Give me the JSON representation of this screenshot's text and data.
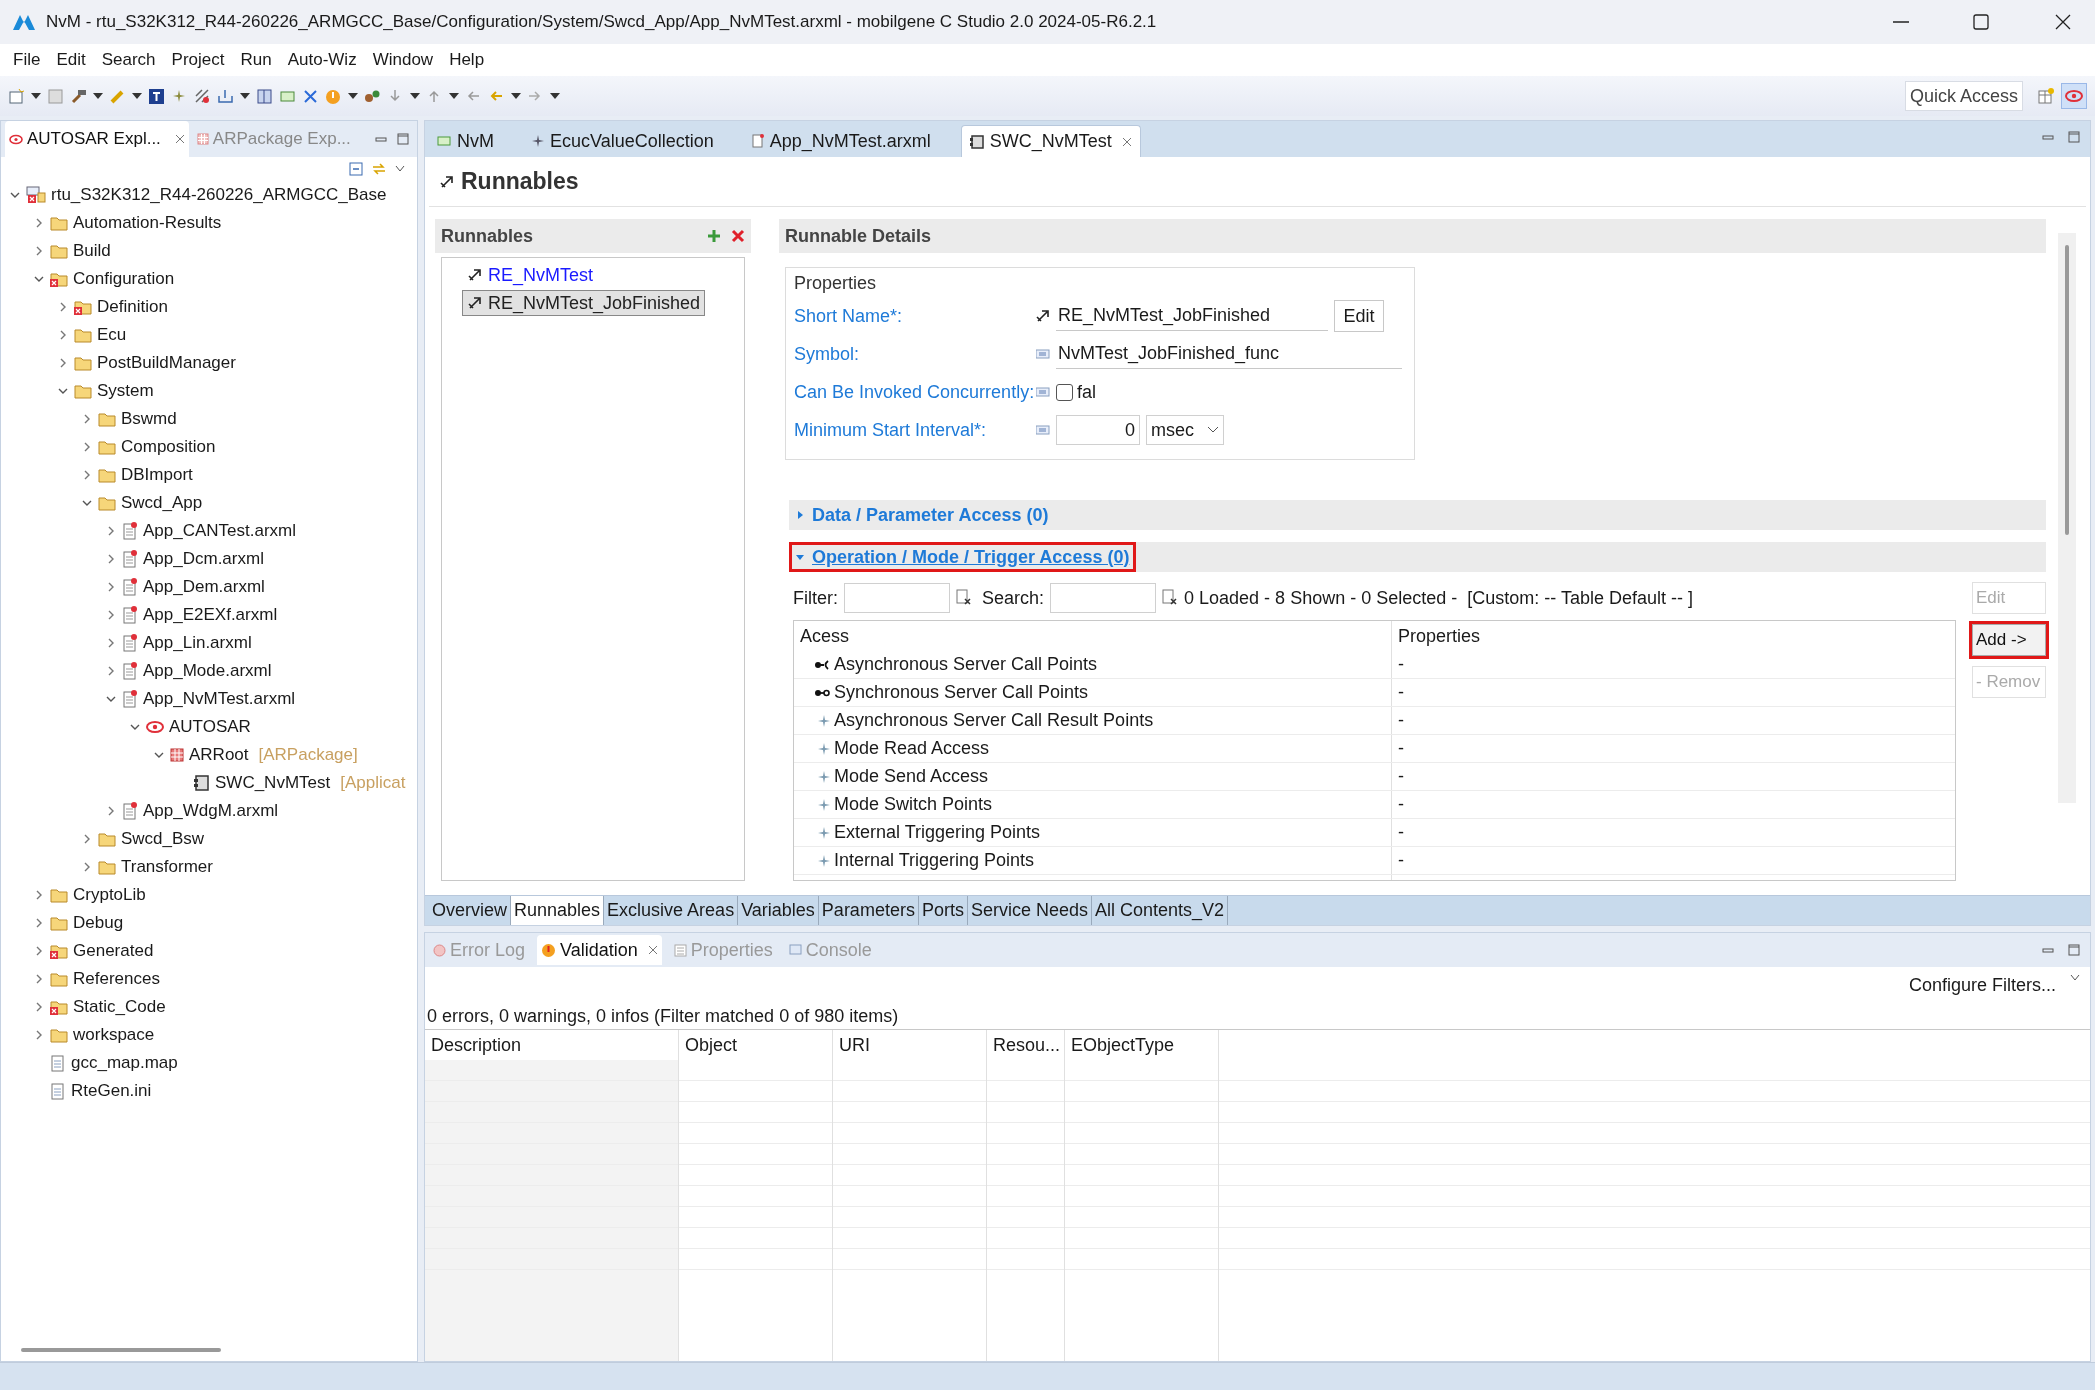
{
  "window": {
    "title": "NvM - rtu_S32K312_R44-260226_ARMGCC_Base/Configuration/System/Swcd_App/App_NvMTest.arxml - mobilgene C Studio 2.0 2024-05-R6.2.1"
  },
  "menu": [
    "File",
    "Edit",
    "Search",
    "Project",
    "Run",
    "Auto-Wiz",
    "Window",
    "Help"
  ],
  "quick_access": "Quick Access",
  "left_tabs": [
    {
      "label": "AUTOSAR Expl...",
      "selected": true
    },
    {
      "label": "ARPackage Exp...",
      "selected": false
    }
  ],
  "tree": {
    "items": [
      {
        "label": "rtu_S32K312_R44-260226_ARMGCC_Base",
        "kind": "project",
        "expanded": true,
        "children": [
          {
            "label": "Automation-Results",
            "kind": "folder",
            "expanded": false
          },
          {
            "label": "Build",
            "kind": "folder",
            "expanded": false
          },
          {
            "label": "Configuration",
            "kind": "folder-error",
            "expanded": true,
            "children": [
              {
                "label": "Definition",
                "kind": "folder-error",
                "expanded": false
              },
              {
                "label": "Ecu",
                "kind": "folder",
                "expanded": false
              },
              {
                "label": "PostBuildManager",
                "kind": "folder",
                "expanded": false
              },
              {
                "label": "System",
                "kind": "folder",
                "expanded": true,
                "children": [
                  {
                    "label": "Bswmd",
                    "kind": "folder",
                    "expanded": false
                  },
                  {
                    "label": "Composition",
                    "kind": "folder",
                    "expanded": false
                  },
                  {
                    "label": "DBImport",
                    "kind": "folder",
                    "expanded": false
                  },
                  {
                    "label": "Swcd_App",
                    "kind": "folder",
                    "expanded": true,
                    "children": [
                      {
                        "label": "App_CANTest.arxml",
                        "kind": "arxml",
                        "expanded": false
                      },
                      {
                        "label": "App_Dcm.arxml",
                        "kind": "arxml",
                        "expanded": false
                      },
                      {
                        "label": "App_Dem.arxml",
                        "kind": "arxml",
                        "expanded": false
                      },
                      {
                        "label": "App_E2EXf.arxml",
                        "kind": "arxml",
                        "expanded": false
                      },
                      {
                        "label": "App_Lin.arxml",
                        "kind": "arxml",
                        "expanded": false
                      },
                      {
                        "label": "App_Mode.arxml",
                        "kind": "arxml",
                        "expanded": false
                      },
                      {
                        "label": "App_NvMTest.arxml",
                        "kind": "arxml",
                        "expanded": true,
                        "children": [
                          {
                            "label": "AUTOSAR",
                            "kind": "autosar",
                            "expanded": true,
                            "children": [
                              {
                                "label": "ARRoot",
                                "type_label": "[ARPackage]",
                                "kind": "package",
                                "expanded": true,
                                "children": [
                                  {
                                    "label": "SWC_NvMTest",
                                    "type_label": "[Applicat",
                                    "kind": "component"
                                  }
                                ]
                              }
                            ]
                          }
                        ]
                      },
                      {
                        "label": "App_WdgM.arxml",
                        "kind": "arxml",
                        "expanded": false
                      }
                    ]
                  },
                  {
                    "label": "Swcd_Bsw",
                    "kind": "folder",
                    "expanded": false
                  },
                  {
                    "label": "Transformer",
                    "kind": "folder",
                    "expanded": false
                  }
                ]
              }
            ]
          },
          {
            "label": "CryptoLib",
            "kind": "folder",
            "expanded": false
          },
          {
            "label": "Debug",
            "kind": "folder",
            "expanded": false
          },
          {
            "label": "Generated",
            "kind": "folder-error",
            "expanded": false
          },
          {
            "label": "References",
            "kind": "folder",
            "expanded": false
          },
          {
            "label": "Static_Code",
            "kind": "folder-error",
            "expanded": false
          },
          {
            "label": "workspace",
            "kind": "folder",
            "expanded": false
          },
          {
            "label": "gcc_map.map",
            "kind": "file"
          },
          {
            "label": "RteGen.ini",
            "kind": "file"
          }
        ]
      }
    ]
  },
  "editor_tabs": [
    {
      "label": "NvM",
      "selected": false
    },
    {
      "label": "EcucValueCollection",
      "selected": false
    },
    {
      "label": "App_NvMTest.arxml",
      "selected": false
    },
    {
      "label": "SWC_NvMTest",
      "selected": true
    }
  ],
  "page_title": "Runnables",
  "runnables": {
    "title": "Runnables",
    "items": [
      {
        "label": "RE_NvMTest",
        "selected": false
      },
      {
        "label": "RE_NvMTest_JobFinished",
        "selected": true
      }
    ]
  },
  "details": {
    "title": "Runnable Details",
    "group": "Properties",
    "short_name": {
      "label": "Short Name*:",
      "value": "RE_NvMTest_JobFinished",
      "button": "Edit"
    },
    "symbol": {
      "label": "Symbol:",
      "value": "NvMTest_JobFinished_func"
    },
    "concurrent": {
      "label": "Can Be Invoked Concurrently:",
      "checked": false,
      "value": "fal"
    },
    "min_interval": {
      "label": "Minimum Start Interval*:",
      "value": "0",
      "unit": "msec"
    }
  },
  "sections": [
    {
      "title": "Data / Parameter Access (0)",
      "expanded": false,
      "highlighted": false
    },
    {
      "title": "Operation / Mode / Trigger Access (0)",
      "expanded": true,
      "highlighted": true
    }
  ],
  "filter": {
    "filter_label": "Filter:",
    "search_label": "Search:",
    "status": "0 Loaded - 8 Shown - 0 Selected -  [Custom: -- Table Default -- ]"
  },
  "access_table": {
    "columns": [
      "Acess",
      "Properties"
    ],
    "rows": [
      {
        "name": "Asynchronous Server Call Points",
        "kind": "async-call",
        "properties": "-"
      },
      {
        "name": "Synchronous Server Call Points",
        "kind": "sync-call",
        "properties": "-"
      },
      {
        "name": "Asynchronous Server Call Result Points",
        "kind": "point",
        "properties": "-"
      },
      {
        "name": "Mode Read Access",
        "kind": "point",
        "properties": "-"
      },
      {
        "name": "Mode Send Access",
        "kind": "point",
        "properties": "-"
      },
      {
        "name": "Mode Switch Points",
        "kind": "point",
        "properties": "-"
      },
      {
        "name": "External Triggering Points",
        "kind": "point",
        "properties": "-"
      },
      {
        "name": "Internal Triggering Points",
        "kind": "point",
        "properties": "-"
      }
    ]
  },
  "side_buttons": [
    {
      "label": "Edit",
      "disabled": true,
      "highlighted": false
    },
    {
      "label": "Add ->",
      "disabled": false,
      "highlighted": true
    },
    {
      "label": "- Remov",
      "disabled": true,
      "highlighted": false
    }
  ],
  "page_tabs": [
    {
      "label": "Overview",
      "selected": false
    },
    {
      "label": "Runnables",
      "selected": true
    },
    {
      "label": "Exclusive Areas",
      "selected": false
    },
    {
      "label": "Variables",
      "selected": false
    },
    {
      "label": "Parameters",
      "selected": false
    },
    {
      "label": "Ports",
      "selected": false
    },
    {
      "label": "Service Needs",
      "selected": false
    },
    {
      "label": "All Contents_V2",
      "selected": false
    }
  ],
  "bottom_tabs": [
    {
      "label": "Error Log",
      "selected": false
    },
    {
      "label": "Validation",
      "selected": true
    },
    {
      "label": "Properties",
      "selected": false
    },
    {
      "label": "Console",
      "selected": false
    }
  ],
  "validation": {
    "configure": "Configure Filters...",
    "summary": "0 errors, 0 warnings, 0 infos (Filter matched 0 of 980 items)",
    "columns": [
      "Description",
      "Object",
      "URI",
      "Resou...",
      "EObjectType"
    ]
  }
}
